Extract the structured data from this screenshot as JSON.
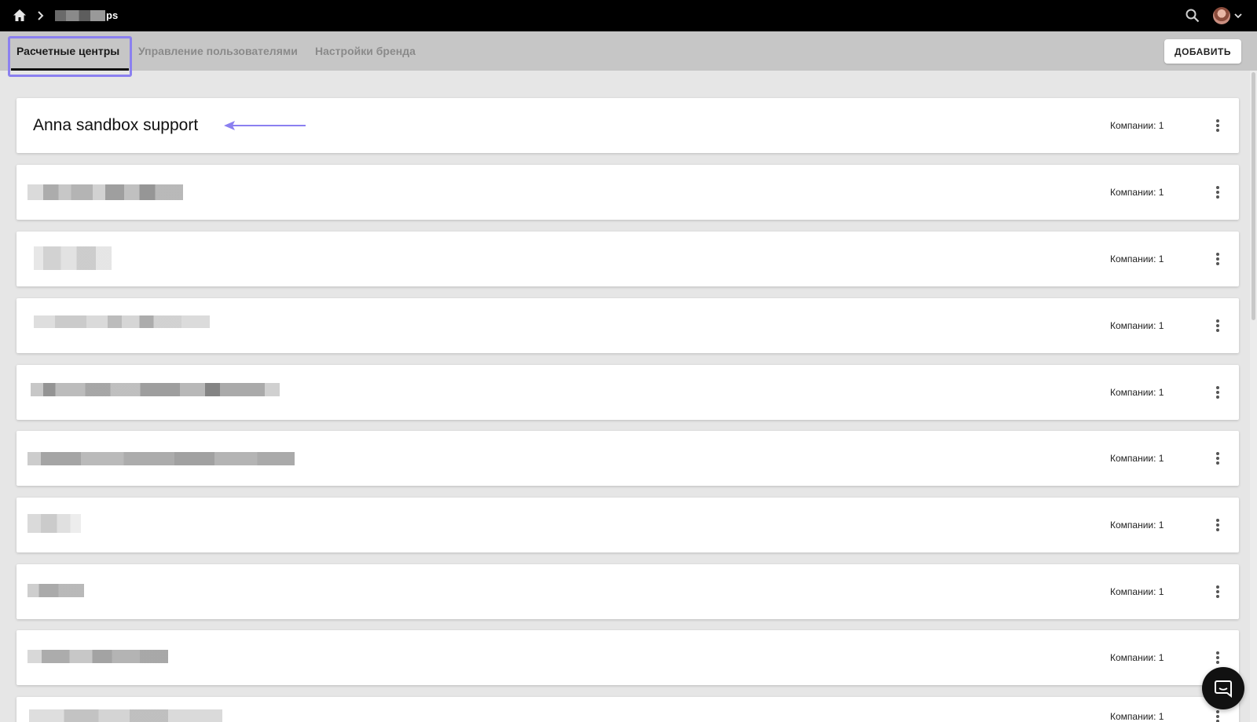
{
  "topbar": {
    "breadcrumb_suffix": "ps",
    "icons": [
      "home-icon",
      "chevron-right-icon",
      "search-icon",
      "avatar",
      "chevron-down-icon"
    ]
  },
  "tabs": [
    {
      "label": "Расчетные центры",
      "active": true
    },
    {
      "label": "Управление пользователями",
      "active": false
    },
    {
      "label": "Настройки бренда",
      "active": false
    }
  ],
  "add_button_label": "ДОБАВИТЬ",
  "rows": [
    {
      "title": "Anna sandbox support",
      "companies": "Компании: 1"
    },
    {
      "title": "",
      "companies": "Компании: 1"
    },
    {
      "title": "",
      "companies": "Компании: 1"
    },
    {
      "title": "",
      "companies": "Компании: 1"
    },
    {
      "title": "",
      "companies": "Компании: 1"
    },
    {
      "title": "",
      "companies": "Компании: 1"
    },
    {
      "title": "",
      "companies": "Компании: 1"
    },
    {
      "title": "",
      "companies": "Компании: 1"
    },
    {
      "title": "",
      "companies": "Компании: 1"
    },
    {
      "title": "",
      "companies": "Компании: 1"
    }
  ],
  "colors": {
    "topbar": "#000000",
    "tabbar": "#c6c6c6",
    "background": "#e6e6e6",
    "highlight": "#8b80f0"
  }
}
